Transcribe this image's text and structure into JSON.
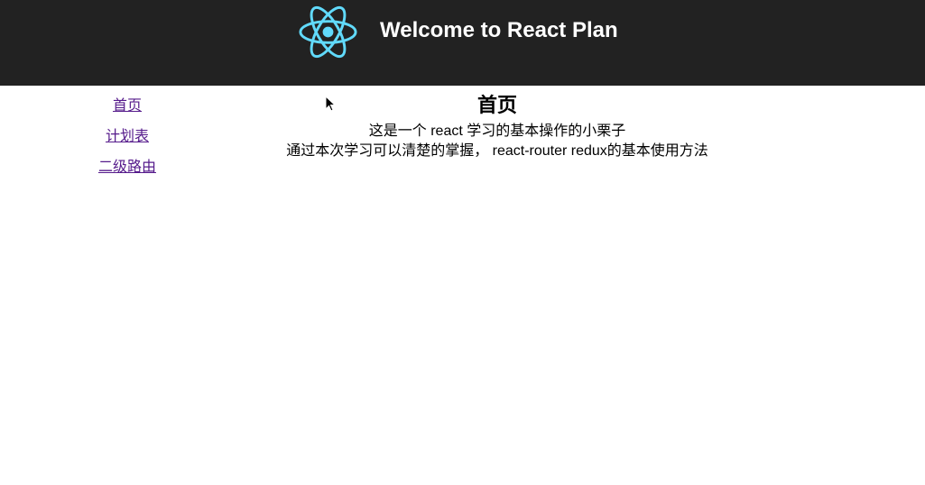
{
  "header": {
    "title": "Welcome to React Plan",
    "logo_icon": "react-atom-icon",
    "logo_color": "#61DAFB"
  },
  "sidebar": {
    "items": [
      {
        "label": "首页"
      },
      {
        "label": "计划表"
      },
      {
        "label": "二级路由"
      }
    ]
  },
  "main": {
    "heading": "首页",
    "lines": [
      "这是一个 react 学习的基本操作的小栗子",
      "通过本次学习可以清楚的掌握， react-router redux的基本使用方法"
    ]
  }
}
